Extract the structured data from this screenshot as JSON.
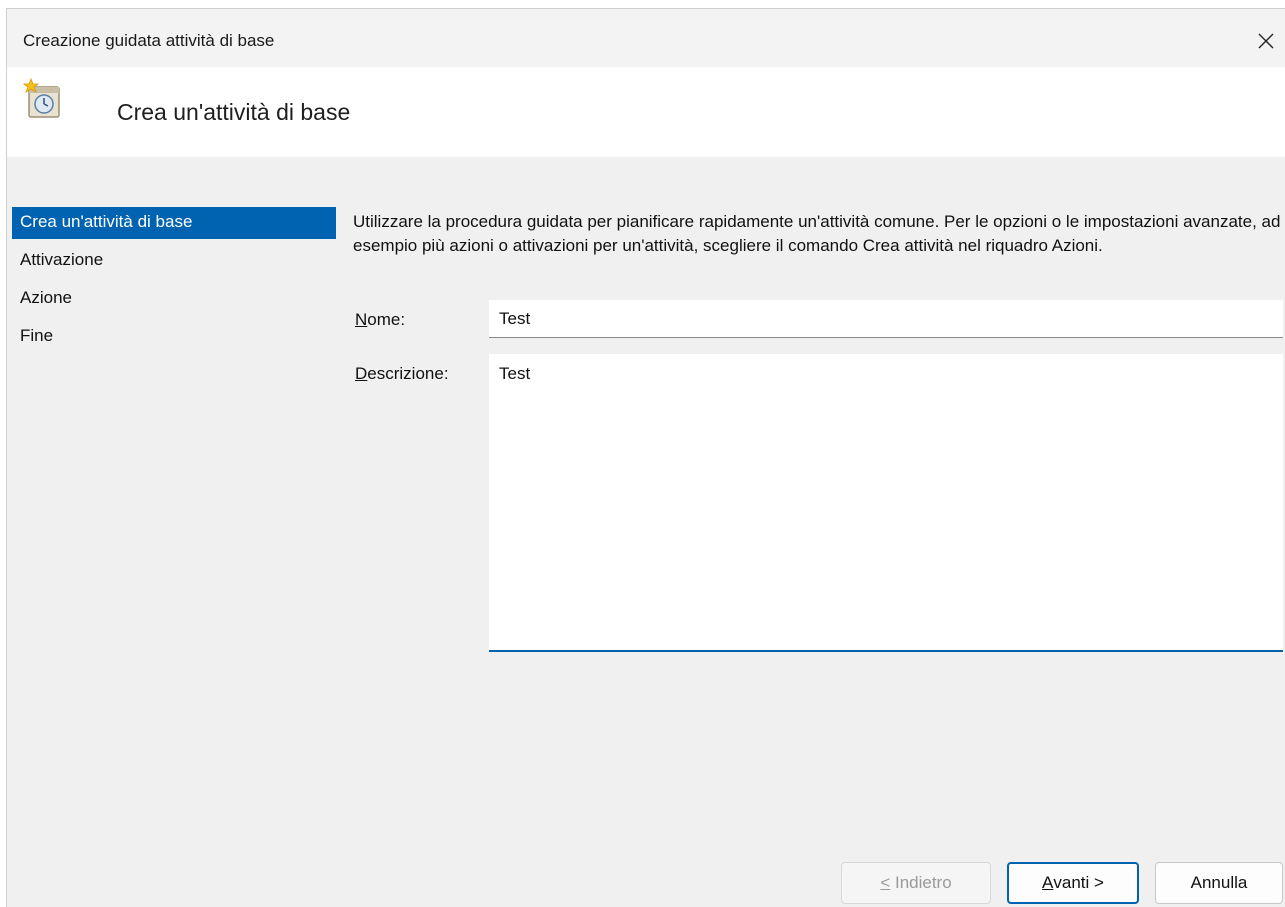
{
  "window": {
    "title": "Creazione guidata attività di base",
    "close_icon": "close-icon"
  },
  "header": {
    "title": "Crea un'attività di base",
    "icon": "task-scheduler-icon"
  },
  "steps": [
    {
      "label": "Crea un'attività di base",
      "active": true
    },
    {
      "label": "Attivazione",
      "active": false
    },
    {
      "label": "Azione",
      "active": false
    },
    {
      "label": "Fine",
      "active": false
    }
  ],
  "intro": "Utilizzare la procedura guidata per pianificare rapidamente un'attività comune. Per le opzioni o le impostazioni avanzate, ad esempio più azioni o attivazioni per un'attività, scegliere il comando Crea attività nel riquadro Azioni.",
  "form": {
    "name_label_mnemonic": "N",
    "name_label_rest": "ome:",
    "name_value": "Test",
    "desc_label_mnemonic": "D",
    "desc_label_rest": "escrizione:",
    "desc_value": "Test"
  },
  "buttons": {
    "back_mnemonic": "<",
    "back_rest": " Indietro",
    "next_mnemonic": "A",
    "next_rest": "vanti >",
    "cancel": "Annulla"
  },
  "colors": {
    "accent": "#0063b1",
    "window_bg": "#f0f0f0"
  }
}
